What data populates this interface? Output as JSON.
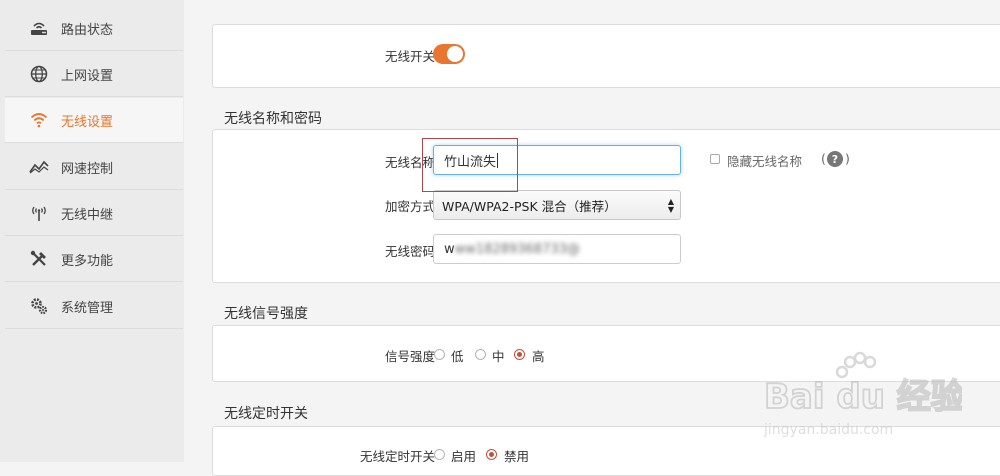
{
  "sidebar": {
    "items": [
      {
        "label": "路由状态",
        "icon": "router-icon",
        "active": false
      },
      {
        "label": "上网设置",
        "icon": "globe-icon",
        "active": false
      },
      {
        "label": "无线设置",
        "icon": "wifi-icon",
        "active": true
      },
      {
        "label": "网速控制",
        "icon": "speed-chart-icon",
        "active": false
      },
      {
        "label": "无线中继",
        "icon": "antenna-icon",
        "active": false
      },
      {
        "label": "更多功能",
        "icon": "tools-icon",
        "active": false
      },
      {
        "label": "系统管理",
        "icon": "gears-icon",
        "active": false
      }
    ]
  },
  "wifi_switch": {
    "label": "无线开关",
    "on": true
  },
  "name_password": {
    "title": "无线名称和密码",
    "ssid_label": "无线名称",
    "ssid_value": "竹山流失",
    "hide_ssid_label": "隐藏无线名称",
    "help": "?",
    "encryption_label": "加密方式",
    "encryption_value": "WPA/WPA2-PSK 混合（推荐）",
    "password_label": "无线密码",
    "password_first_char": "w"
  },
  "signal": {
    "title": "无线信号强度",
    "label": "信号强度",
    "options": [
      "低",
      "中",
      "高"
    ],
    "selected": "高"
  },
  "timer": {
    "title": "无线定时开关",
    "label": "无线定时开关",
    "options": [
      "启用",
      "禁用"
    ],
    "selected": "禁用"
  },
  "watermark": {
    "brand": "Bai du 经验",
    "url": "jingyan.baidu.com"
  },
  "colors": {
    "accent": "#e8762e",
    "radio_on": "#c0533a",
    "highlight": "#b3454c"
  }
}
